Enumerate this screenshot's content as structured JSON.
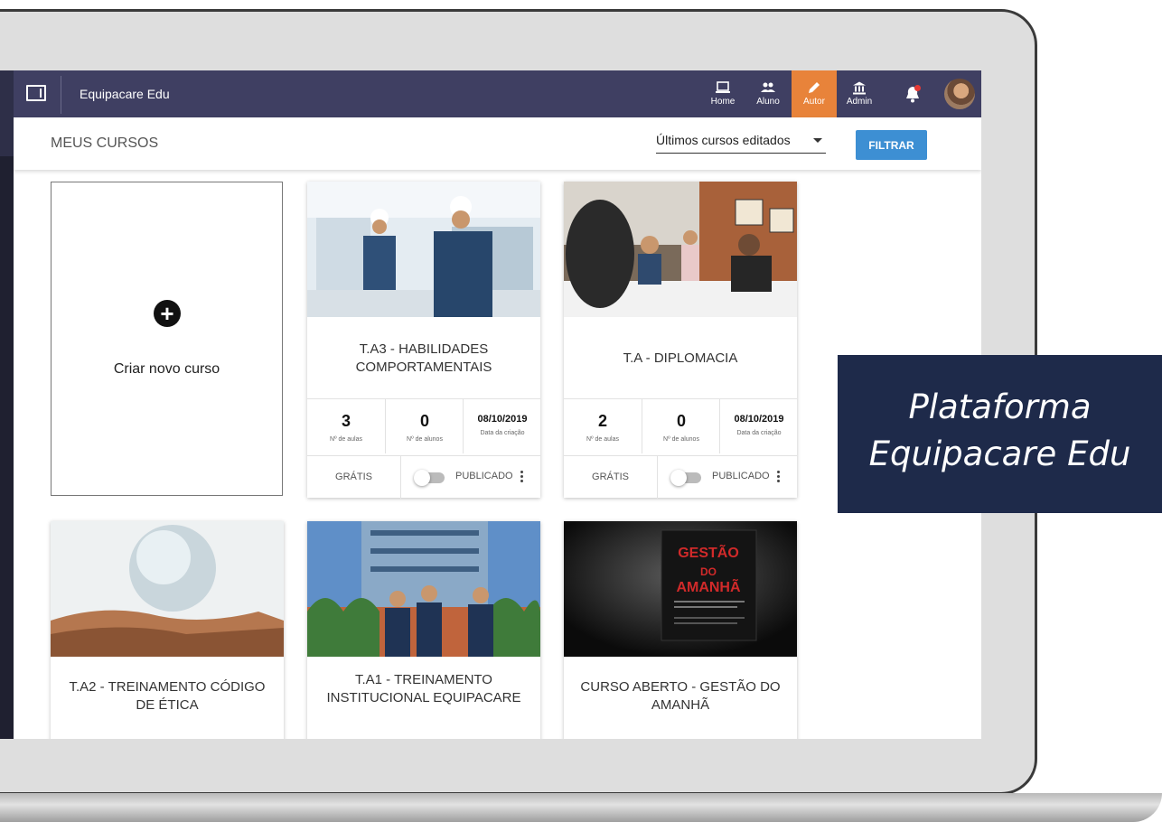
{
  "app": {
    "title": "Equipacare Edu"
  },
  "nav": {
    "items": [
      {
        "label": "Home",
        "icon": "laptop-icon"
      },
      {
        "label": "Aluno",
        "icon": "people-icon"
      },
      {
        "label": "Autor",
        "icon": "pencil-icon",
        "active": true
      },
      {
        "label": "Admin",
        "icon": "bank-icon"
      }
    ],
    "accent": "#e8833a",
    "bar_color": "#3f3f62"
  },
  "page": {
    "title": "MEUS CURSOS",
    "sort_value": "Últimos cursos editados",
    "filter_label": "FILTRAR",
    "create_label": "Criar novo curso"
  },
  "courses": [
    {
      "title": "T.A3 - HABILIDADES COMPORTAMENTAIS",
      "aulas": "3",
      "alunos": "0",
      "date": "08/10/2019",
      "aulas_label": "Nº de aulas",
      "alunos_label": "Nº de alunos",
      "date_label": "Data da criação",
      "price": "GRÁTIS",
      "status": "PUBLICADO"
    },
    {
      "title": "T.A - DIPLOMACIA",
      "aulas": "2",
      "alunos": "0",
      "date": "08/10/2019",
      "aulas_label": "Nº de aulas",
      "alunos_label": "Nº de alunos",
      "date_label": "Data da criação",
      "price": "GRÁTIS",
      "status": "PUBLICADO"
    },
    {
      "title": "T.A2 - TREINAMENTO CÓDIGO DE ÉTICA"
    },
    {
      "title": "T.A1 - TREINAMENTO INSTITUCIONAL EQUIPACARE"
    },
    {
      "title": "CURSO ABERTO - GESTÃO DO AMANHÃ",
      "book": {
        "title": "GESTÃO DO AMANHÃ"
      }
    }
  ],
  "overlay": {
    "line1": "Plataforma",
    "line2": "Equipacare Edu"
  }
}
